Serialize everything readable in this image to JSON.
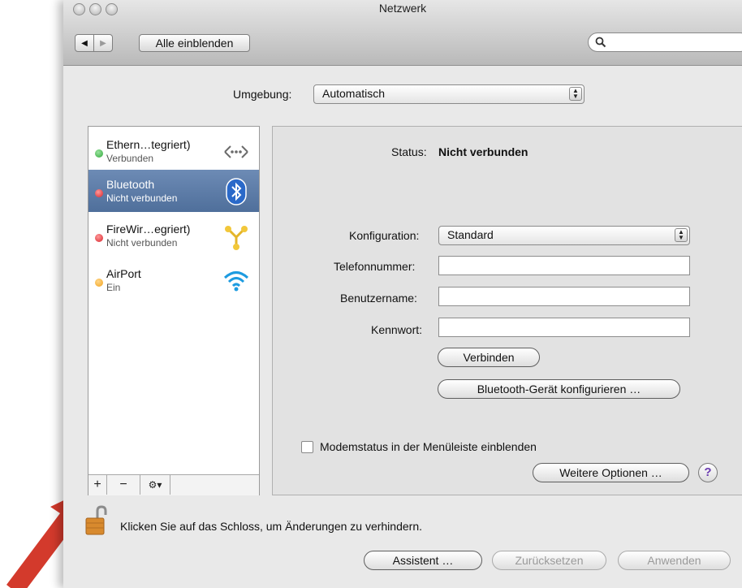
{
  "window": {
    "title": "Netzwerk"
  },
  "toolbar": {
    "show_all_label": "Alle einblenden",
    "back_glyph": "◀",
    "forward_glyph": "▶"
  },
  "location": {
    "label": "Umgebung:",
    "value": "Automatisch"
  },
  "services": [
    {
      "name": "Ethern…tegriert)",
      "status": "Verbunden",
      "dot_color": "#2fa83a",
      "icon": "ethernet-icon"
    },
    {
      "name": "Bluetooth",
      "status": "Nicht verbunden",
      "dot_color": "#d8222a",
      "icon": "bluetooth-icon"
    },
    {
      "name": "FireWir…egriert)",
      "status": "Nicht verbunden",
      "dot_color": "#d8222a",
      "icon": "firewire-icon"
    },
    {
      "name": "AirPort",
      "status": "Ein",
      "dot_color": "#f2a21c",
      "icon": "airport-icon"
    }
  ],
  "list_buttons": {
    "add": "+",
    "remove": "−",
    "action": "⚙▾"
  },
  "detail": {
    "status_label": "Status:",
    "status_value": "Nicht verbunden",
    "config_label": "Konfiguration:",
    "config_value": "Standard",
    "phone_label": "Telefonnummer:",
    "phone_value": "",
    "user_label": "Benutzername:",
    "user_value": "",
    "password_label": "Kennwort:",
    "password_value": "",
    "connect_button": "Verbinden",
    "configure_button": "Bluetooth-Gerät konfigurieren …",
    "modem_checkbox_label": "Modemstatus in der Menüleiste einblenden",
    "more_options_button": "Weitere Optionen …",
    "help_glyph": "?"
  },
  "lock": {
    "text": "Klicken Sie auf das Schloss, um Änderungen zu verhindern."
  },
  "footer": {
    "assistant_button": "Assistent …",
    "revert_button": "Zurücksetzen",
    "apply_button": "Anwenden"
  },
  "colors": {
    "selection": "#5f7ea9",
    "annotation_arrow": "#d33a2c"
  }
}
